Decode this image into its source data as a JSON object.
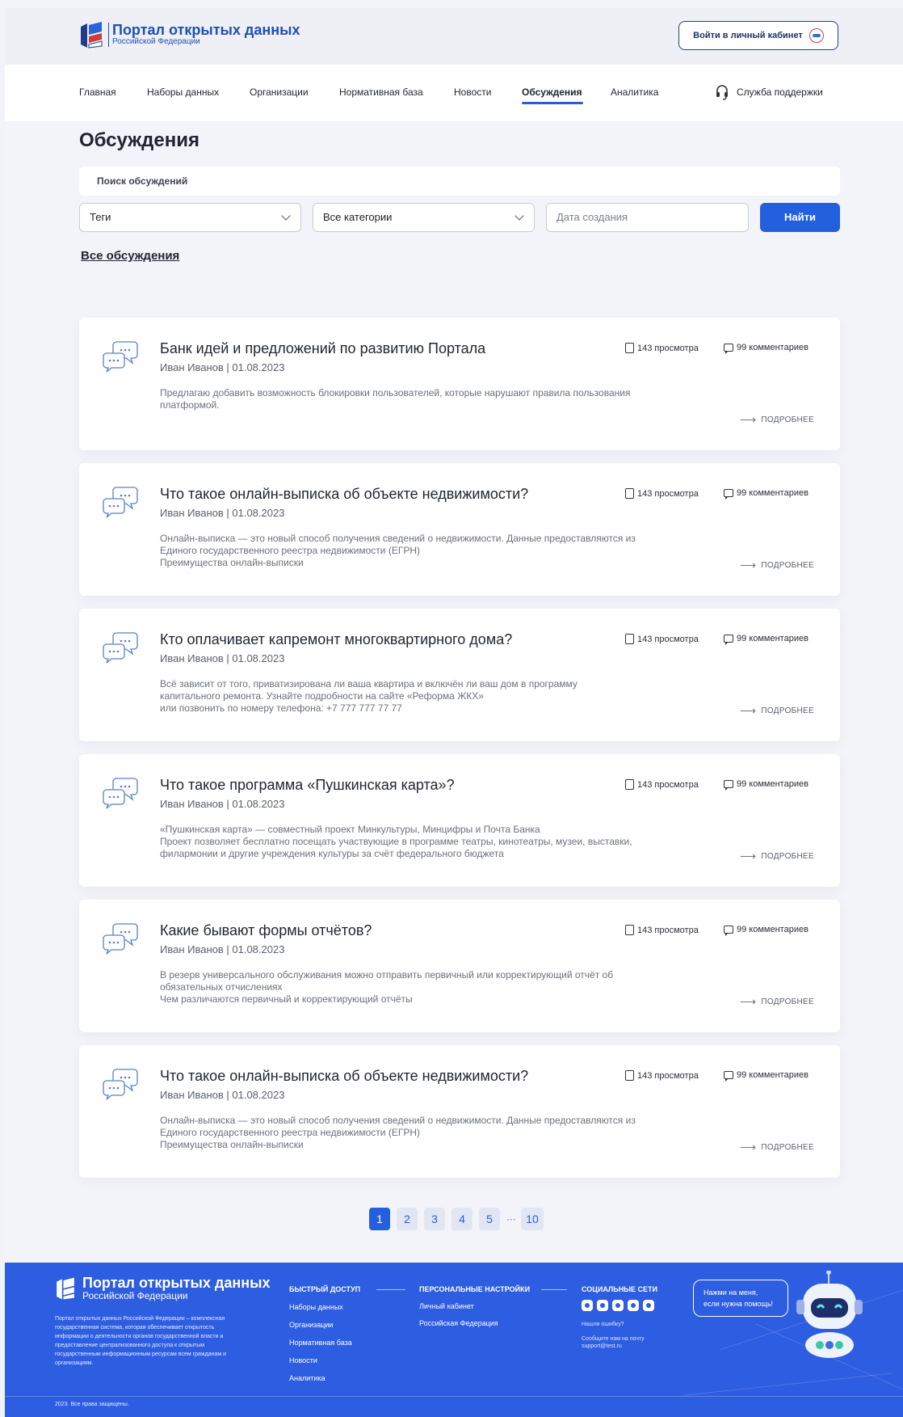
{
  "header": {
    "logo_title": "Портал открытых данных",
    "logo_subtitle": "Российской Федерации",
    "login_label": "Войти в личный кабинет",
    "support_label": "Служба поддержки"
  },
  "nav": {
    "items": [
      {
        "label": "Главная"
      },
      {
        "label": "Наборы данных"
      },
      {
        "label": "Организации"
      },
      {
        "label": "Нормативная база"
      },
      {
        "label": "Новости"
      },
      {
        "label": "Обсуждения",
        "active": true
      },
      {
        "label": "Аналитика"
      }
    ]
  },
  "main": {
    "title": "Обсуждения",
    "search_placeholder": "Поиск обсуждений",
    "filters": {
      "tags": "Теги",
      "category": "Все категории",
      "date_placeholder": "Дата создания",
      "find_label": "Найти"
    },
    "all_link": "Все обсуждения",
    "more_label": "ПОДРОБНЕЕ",
    "cards": [
      {
        "title": "Банк идей и предложений по развитию Портала",
        "meta": "Иван Иванов | 01.08.2023",
        "text": [
          "Предлагаю добавить возможность блокировки пользователей, которые нарушают правила пользования",
          "платформой."
        ],
        "views": "143 просмотра",
        "comments": "99 комментариев"
      },
      {
        "title": "Что такое онлайн-выписка об объекте недвижимости?",
        "meta": "Иван Иванов | 01.08.2023",
        "text": [
          "Онлайн-выписка — это новый способ получения сведений о недвижимости. Данные предоставляются из",
          "Единого государственного реестра недвижимости (ЕГРН)",
          "Преимущества онлайн-выписки"
        ],
        "views": "143 просмотра",
        "comments": "99 комментариев"
      },
      {
        "title": "Кто оплачивает капремонт многоквартирного дома?",
        "meta": "Иван Иванов | 01.08.2023",
        "text": [
          "Всё зависит от того, приватизирована ли ваша квартира и включён ли ваш дом в программу",
          "капитального ремонта. Узнайте подробности на сайте «Реформа ЖКХ»",
          "или позвонить по номеру телефона: +7 777 777 77 77"
        ],
        "views": "143 просмотра",
        "comments": "99 комментариев"
      },
      {
        "title": "Что такое программа «Пушкинская карта»?",
        "meta": "Иван Иванов | 01.08.2023",
        "text": [
          "«Пушкинская карта» — совместный проект Минкультуры, Минцифры и Почта Банка",
          "Проект позволяет бесплатно посещать участвующие в программе театры, кинотеатры, музеи, выставки,",
          "филармонии и другие учреждения культуры за счёт федерального бюджета"
        ],
        "views": "143 просмотра",
        "comments": "99 комментариев"
      },
      {
        "title": "Какие бывают формы отчётов?",
        "meta": "Иван Иванов | 01.08.2023",
        "text": [
          "В резерв универсального обслуживания можно отправить первичный или корректирующий отчёт об",
          "обязательных отчислениях",
          "Чем различаются первичный и корректирующий отчёты"
        ],
        "views": "143 просмотра",
        "comments": "99 комментариев"
      },
      {
        "title": "Что такое онлайн-выписка об объекте недвижимости?",
        "meta": "Иван Иванов | 01.08.2023",
        "text": [
          "Онлайн-выписка — это новый способ получения сведений о недвижимости. Данные предоставляются из",
          "Единого государственного реестра недвижимости (ЕГРН)",
          "Преимущества онлайн-выписки"
        ],
        "views": "143 просмотра",
        "comments": "99 комментариев"
      }
    ]
  },
  "pagination": {
    "pages": [
      "1",
      "2",
      "3",
      "4",
      "5"
    ],
    "ellipsis": "···",
    "last": "10",
    "current": "1"
  },
  "footer": {
    "logo_title": "Портал открытых данных",
    "logo_subtitle": "Российской Федерации",
    "description": "Портал открытых данных Российской Федерации – комплексная государственная система, которая обеспечивает открытость информации о деятельности органов государственной власти и предоставление централизованного доступа к открытым государственным информационным ресурсам всем гражданам и организациям.",
    "quick_title": "БЫСТРЫЙ ДОСТУП",
    "quick_links": [
      "Наборы данных",
      "Организации",
      "Нормативная база",
      "Новости",
      "Аналитика"
    ],
    "personal_title": "ПЕРСОНАЛЬНЫЕ НАСТРОЙКИ",
    "personal_links": [
      "Личный кабинет",
      "Российская Федерация"
    ],
    "social_title": "СОЦИАЛЬНЫЕ СЕТИ",
    "found_error": "Нашли ошибку?",
    "report_line1": "Сообщите нам на почту",
    "report_line2": "support@test.ru",
    "help_bubble_line1": "Нажми на меня,",
    "help_bubble_line2": "если нужна помощь!",
    "copyright": "2023. Все права защищены."
  },
  "colors": {
    "accent": "#2460de",
    "footer_bg": "#2d5de0",
    "page_bg": "#f3f4f9"
  }
}
